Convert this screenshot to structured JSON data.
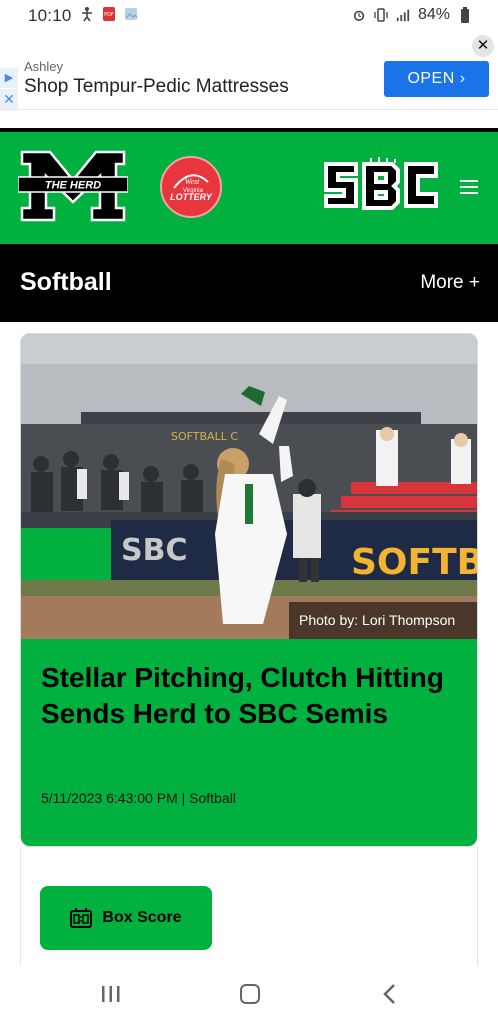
{
  "status_bar": {
    "time": "10:10",
    "battery": "84%"
  },
  "ad": {
    "advertiser": "Ashley",
    "headline": "Shop Tempur-Pedic Mattresses",
    "cta": "OPEN",
    "close": "✕"
  },
  "header": {
    "herd_logo_text": "THE HERD",
    "lottery_logo_text": "West Virginia LOTTERY",
    "sbc_logo_text": "SBC"
  },
  "section": {
    "title": "Softball",
    "more": "More +"
  },
  "article": {
    "photo_credit": "Photo by: Lori Thompson",
    "photo_banner_text": "SOFTBA",
    "photo_sbc_text": "SBC",
    "photo_sign_text": "SOFTBALL C",
    "headline": "Stellar Pitching, Clutch Hitting Sends Herd to SBC Semis",
    "meta": "5/11/2023 6:43:00 PM | Softball"
  },
  "actions": {
    "box_score": "Box Score"
  },
  "colors": {
    "brand_green": "#00b140",
    "ad_blue": "#1a73e8",
    "lottery_red": "#e8363f"
  }
}
